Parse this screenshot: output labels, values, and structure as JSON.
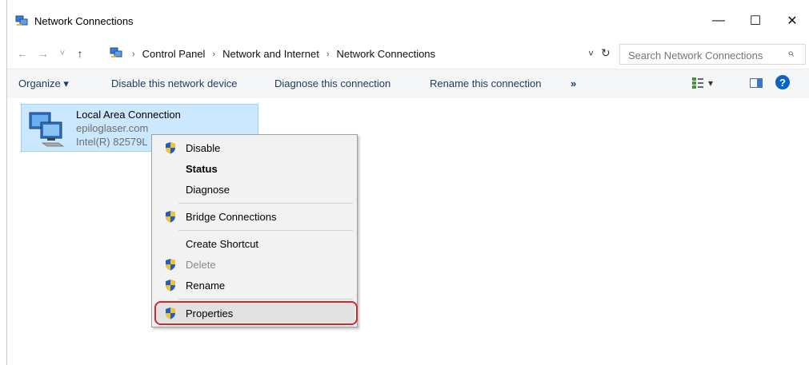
{
  "window": {
    "title": "Network Connections",
    "minimize_glyph": "—",
    "maximize_glyph": "☐",
    "close_glyph": "✕"
  },
  "address": {
    "back_glyph": "←",
    "forward_glyph": "→",
    "recent_glyph": "˅",
    "up_glyph": "↑",
    "breadcrumb": [
      "Control Panel",
      "Network and Internet",
      "Network Connections"
    ],
    "separator": "›",
    "dropdown_glyph": "˅",
    "refresh_glyph": "↻"
  },
  "search": {
    "placeholder": "Search Network Connections",
    "icon_glyph": "⌕"
  },
  "toolbar": {
    "organize": "Organize ▾",
    "disable": "Disable this network device",
    "diagnose": "Diagnose this connection",
    "rename": "Rename this connection",
    "more": "»",
    "view_dropdown": "▾",
    "help_glyph": "?"
  },
  "connection": {
    "name": "Local Area Connection",
    "domain": "epiloglaser.com",
    "adapter": "Intel(R) 82579L"
  },
  "context_menu": {
    "items": [
      {
        "label": "Disable",
        "shield": true,
        "bold": false,
        "disabled": false
      },
      {
        "label": "Status",
        "shield": false,
        "bold": true,
        "disabled": false
      },
      {
        "label": "Diagnose",
        "shield": false,
        "bold": false,
        "disabled": false
      },
      {
        "label": "Bridge Connections",
        "shield": true,
        "bold": false,
        "disabled": false
      },
      {
        "label": "Create Shortcut",
        "shield": false,
        "bold": false,
        "disabled": false
      },
      {
        "label": "Delete",
        "shield": true,
        "bold": false,
        "disabled": true
      },
      {
        "label": "Rename",
        "shield": true,
        "bold": false,
        "disabled": false
      },
      {
        "label": "Properties",
        "shield": true,
        "bold": false,
        "disabled": false,
        "highlighted": true
      }
    ]
  },
  "colors": {
    "selection_bg": "#cce8ff",
    "highlight_outline": "#d1262b",
    "help_blue": "#0a63c9"
  }
}
